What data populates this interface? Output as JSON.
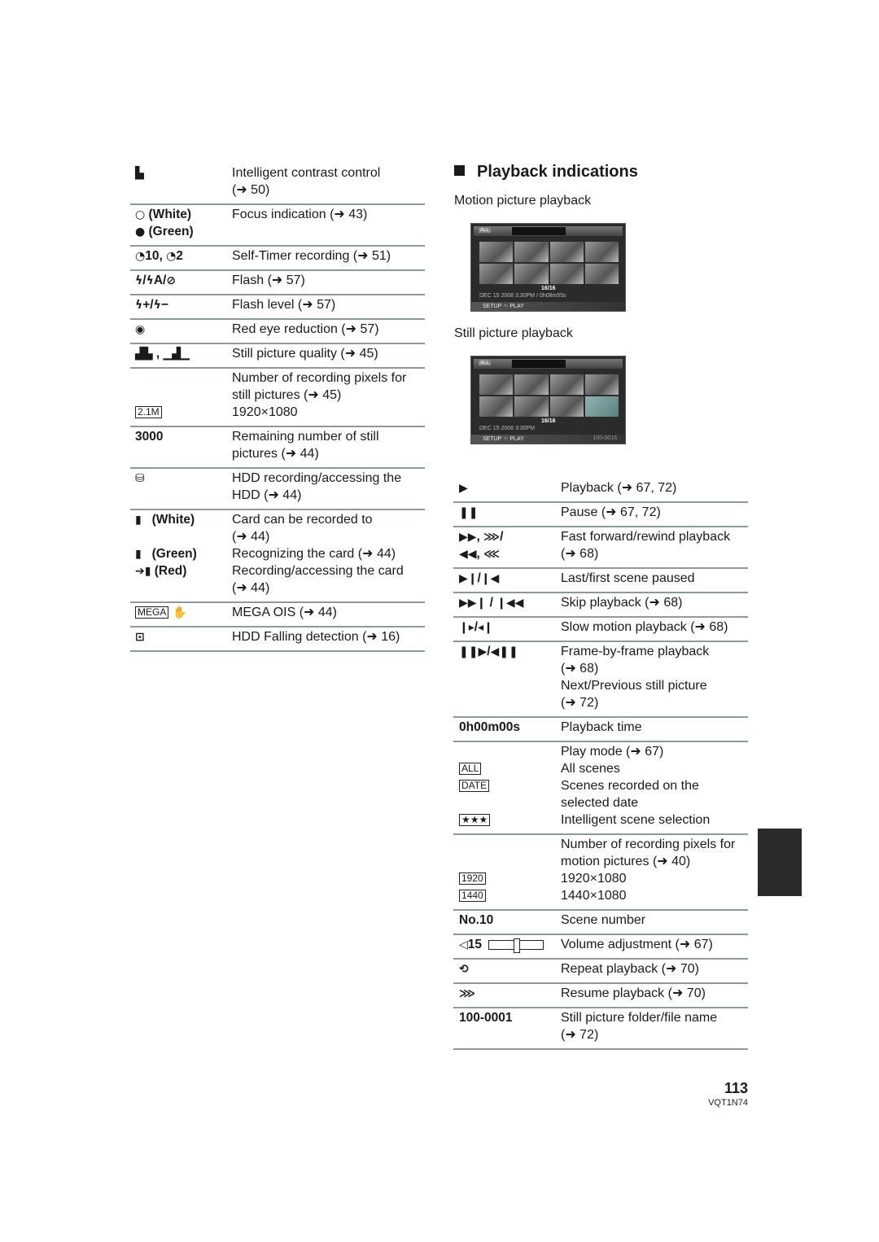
{
  "left_table": {
    "rows": [
      {
        "icons": [
          [
            {
              "i": "intelligent-contrast-icon",
              "g": "▙"
            }
          ]
        ],
        "desc": [
          "Intelligent contrast control",
          "(➜ 50)"
        ]
      },
      {
        "icons": [
          [
            {
              "i": "focus-white-icon",
              "g": "○"
            },
            {
              "t": " (White)"
            }
          ],
          [
            {
              "i": "focus-green-icon",
              "g": "●"
            },
            {
              "t": " (Green)"
            }
          ]
        ],
        "desc": [
          "Focus indication (➜ 43)"
        ]
      },
      {
        "icons": [
          [
            {
              "i": "self-timer-icon",
              "g": "◔"
            },
            {
              "t": "10, "
            },
            {
              "i": "self-timer-icon",
              "g": "◔"
            },
            {
              "t": "2"
            }
          ]
        ],
        "desc": [
          "Self-Timer recording (➜ 51)"
        ]
      },
      {
        "icons": [
          [
            {
              "i": "flash-icon",
              "g": "ϟ"
            },
            {
              "t": "/"
            },
            {
              "i": "flash-auto-icon",
              "g": "ϟ"
            },
            {
              "t": "A/"
            },
            {
              "i": "flash-off-icon",
              "g": "⊘"
            }
          ]
        ],
        "desc": [
          "Flash (➜ 57)"
        ]
      },
      {
        "icons": [
          [
            {
              "i": "flash-plus-icon",
              "g": "ϟ"
            },
            {
              "t": "+/"
            },
            {
              "i": "flash-minus-icon",
              "g": "ϟ"
            },
            {
              "t": "−"
            }
          ]
        ],
        "desc": [
          "Flash level (➜ 57)"
        ]
      },
      {
        "icons": [
          [
            {
              "i": "red-eye-icon",
              "g": "◉"
            }
          ]
        ],
        "desc": [
          "Red eye reduction (➜ 57)"
        ]
      },
      {
        "icons": [
          [
            {
              "i": "quality-fine-icon",
              "g": "▟▙"
            },
            {
              "t": " , "
            },
            {
              "i": "quality-normal-icon",
              "g": "▁▟▁"
            }
          ]
        ],
        "desc": [
          "Still picture quality (➜ 45)"
        ]
      },
      {
        "icons": [
          [],
          [],
          [
            {
              "b": "2.1M",
              "i": "resolution-2-1m-icon"
            }
          ]
        ],
        "desc": [
          "Number of recording pixels for",
          "still pictures (➜ 45)",
          "1920×1080"
        ]
      },
      {
        "icons": [
          [
            {
              "t": "3000"
            }
          ]
        ],
        "desc": [
          "Remaining number of still",
          "pictures (➜ 44)"
        ]
      },
      {
        "icons": [
          [
            {
              "i": "hdd-access-icon",
              "g": "⛁"
            }
          ]
        ],
        "desc": [
          "HDD recording/accessing the",
          "HDD (➜ 44)"
        ]
      },
      {
        "icons": [
          [
            {
              "i": "card-icon",
              "g": "▮"
            },
            {
              "t": "   (White)"
            }
          ],
          [],
          [
            {
              "i": "card-icon",
              "g": "▮"
            },
            {
              "t": "   (Green)"
            }
          ],
          [
            {
              "i": "card-access-icon",
              "g": "➔▮"
            },
            {
              "t": " (Red)"
            }
          ],
          []
        ],
        "desc": [
          "Card can be recorded to",
          "(➜ 44)",
          "Recognizing the card (➜ 44)",
          "Recording/accessing the card",
          "(➜ 44)"
        ]
      },
      {
        "icons": [
          [
            {
              "b": "MEGA",
              "i": "mega-icon"
            },
            {
              "i": "ois-hand-icon",
              "g": " ✋"
            }
          ]
        ],
        "desc": [
          "MEGA OIS (➜ 44)"
        ]
      },
      {
        "icons": [
          [
            {
              "i": "hdd-fall-detection-icon",
              "g": "⊡"
            }
          ]
        ],
        "desc": [
          "HDD Falling detection (➜ 16)"
        ]
      }
    ]
  },
  "right": {
    "heading": "Playback indications",
    "motion_caption": "Motion picture playback",
    "still_caption": "Still picture playback",
    "motion_screen": {
      "mode": "ALL",
      "counter": "16/16",
      "info": "DEC 15 2008  3:30PM  /  0h08m55s",
      "setup": "SETUP  ☜ PLAY",
      "file": ""
    },
    "still_screen": {
      "mode": "ALL",
      "counter": "16/16",
      "info": "DEC 15 2008  3:30PM",
      "setup": "SETUP  ☜ PLAY",
      "file": "100-0016"
    }
  },
  "right_table": {
    "rows": [
      {
        "icons": [
          [
            {
              "i": "play-icon",
              "g": "▶"
            }
          ]
        ],
        "desc": [
          "Playback (➜ 67, 72)"
        ]
      },
      {
        "icons": [
          [
            {
              "i": "pause-icon",
              "g": "❚❚"
            }
          ]
        ],
        "desc": [
          "Pause (➜ 67, 72)"
        ]
      },
      {
        "icons": [
          [
            {
              "i": "fast-forward-icon",
              "g": "▶▶"
            },
            {
              "t": ", "
            },
            {
              "i": "fast-forward-fast-icon",
              "g": "⋙"
            },
            {
              "t": "/"
            }
          ],
          [
            {
              "i": "rewind-icon",
              "g": "◀◀"
            },
            {
              "t": ", "
            },
            {
              "i": "rewind-fast-icon",
              "g": "⋘"
            }
          ]
        ],
        "desc": [
          "Fast forward/rewind playback",
          "(➜ 68)"
        ]
      },
      {
        "icons": [
          [
            {
              "i": "last-scene-icon",
              "g": "▶❙"
            },
            {
              "t": "/"
            },
            {
              "i": "first-scene-icon",
              "g": "❙◀"
            }
          ]
        ],
        "desc": [
          "Last/first scene paused"
        ]
      },
      {
        "icons": [
          [
            {
              "i": "skip-forward-icon",
              "g": "▶▶❙"
            },
            {
              "t": " / "
            },
            {
              "i": "skip-back-icon",
              "g": "❙◀◀"
            }
          ]
        ],
        "desc": [
          "Skip playback (➜ 68)"
        ]
      },
      {
        "icons": [
          [
            {
              "i": "slow-forward-icon",
              "g": "❙▸"
            },
            {
              "t": "/"
            },
            {
              "i": "slow-back-icon",
              "g": "◂❙"
            }
          ]
        ],
        "desc": [
          "Slow motion playback (➜ 68)"
        ]
      },
      {
        "icons": [
          [
            {
              "i": "frame-forward-icon",
              "g": "❚❚▶"
            },
            {
              "t": "/"
            },
            {
              "i": "frame-back-icon",
              "g": "◀❚❚"
            }
          ]
        ],
        "desc": [
          "Frame-by-frame playback",
          "(➜ 68)",
          "Next/Previous still picture",
          "(➜ 72)"
        ]
      },
      {
        "icons": [
          [
            {
              "t": "0h00m00s"
            }
          ]
        ],
        "desc": [
          "Playback time"
        ]
      },
      {
        "icons": [
          [],
          [
            {
              "b": "ALL",
              "i": "all-scenes-icon"
            }
          ],
          [
            {
              "b": "DATE",
              "i": "date-icon"
            }
          ],
          [],
          [
            {
              "b": "★★★",
              "i": "intelligent-scene-icon"
            }
          ]
        ],
        "desc": [
          "Play mode (➜ 67)",
          "All scenes",
          "Scenes recorded on the",
          "selected date",
          "Intelligent scene selection"
        ]
      },
      {
        "icons": [
          [],
          [],
          [
            {
              "b": "1920",
              "i": "resolution-1920-icon"
            }
          ],
          [
            {
              "b": "1440",
              "i": "resolution-1440-icon"
            }
          ]
        ],
        "desc": [
          "Number of recording pixels for",
          "motion pictures (➜ 40)",
          "1920×1080",
          "1440×1080"
        ]
      },
      {
        "icons": [
          [
            {
              "t": "No.10"
            }
          ]
        ],
        "desc": [
          "Scene number"
        ]
      },
      {
        "icons": [
          [
            {
              "i": "speaker-icon",
              "g": "◁"
            },
            {
              "t": "15"
            },
            {
              "s": 0.45
            }
          ]
        ],
        "desc": [
          "Volume adjustment (➜ 67)"
        ]
      },
      {
        "icons": [
          [
            {
              "i": "repeat-icon",
              "g": "⟲"
            }
          ]
        ],
        "desc": [
          "Repeat playback (➜ 70)"
        ]
      },
      {
        "icons": [
          [
            {
              "i": "resume-icon",
              "g": "⋙"
            }
          ]
        ],
        "desc": [
          "Resume playback (➜ 70)"
        ]
      },
      {
        "icons": [
          [
            {
              "t": "100-0001"
            }
          ]
        ],
        "desc": [
          "Still picture folder/file name",
          "(➜ 72)"
        ]
      }
    ]
  },
  "footer": {
    "page_number": "113",
    "doc_code": "VQT1N74"
  }
}
